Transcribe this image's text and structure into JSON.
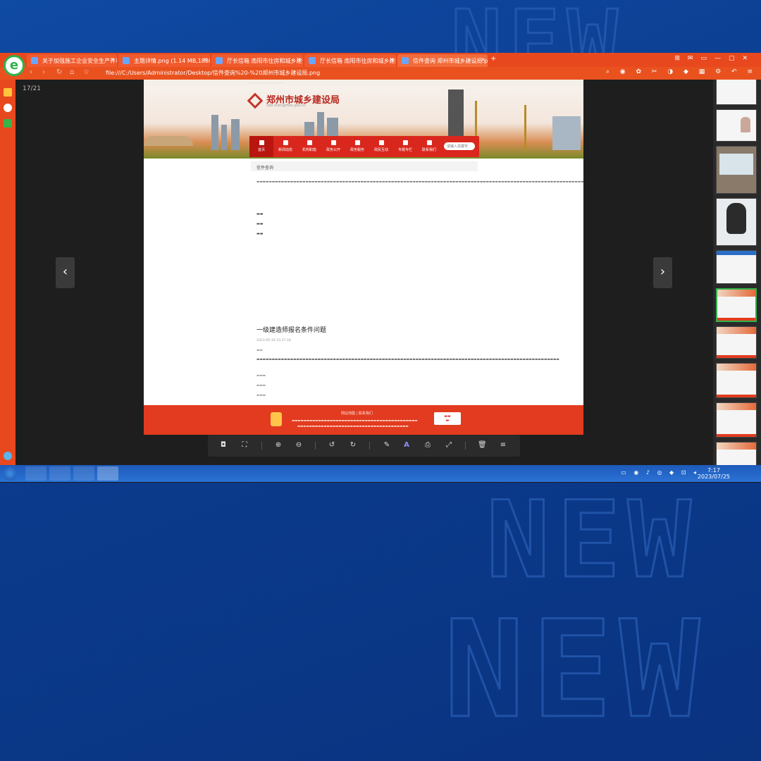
{
  "browser": {
    "tabs": [
      {
        "label": "关于加强施工企业安全生产许可"
      },
      {
        "label": "主题详情.png (1.14 MB,1880*"
      },
      {
        "label": "厅长信箱 南阳市住房和城乡建设"
      },
      {
        "label": "厅长信箱 南阳市住房和城乡建设"
      },
      {
        "label": "信件查询 郑州市城乡建设局.p"
      }
    ],
    "url": "file:///C:/Users/Administrator/Desktop/信件查询%20-%20郑州市城乡建设局.png"
  },
  "viewer": {
    "page_counter": "17/21"
  },
  "document": {
    "site_title": "郑州市城乡建设局",
    "site_subtitle": "zzjs.zhengzhou.gov.cn",
    "menu": [
      {
        "label": "首页"
      },
      {
        "label": "新闻动态"
      },
      {
        "label": "机构职能"
      },
      {
        "label": "政务公开"
      },
      {
        "label": "政务服务"
      },
      {
        "label": "政民互动"
      },
      {
        "label": "专题专栏"
      },
      {
        "label": "联系我们"
      }
    ],
    "search_placeholder": "请输入关键字",
    "breadcrumb": "信件查询",
    "question_title": "一级建造师报名条件问题",
    "date": "2023-05-16 15:37:18",
    "footer_links": "网站地图 | 联系我们"
  },
  "taskbar": {
    "time": "7:17",
    "date": "2023/07/25"
  },
  "colors": {
    "browser_chrome": "#e8481e",
    "site_red": "#d9271d",
    "desktop_blue": "#0b3b8d",
    "thumb_selected": "#2fb34a"
  }
}
